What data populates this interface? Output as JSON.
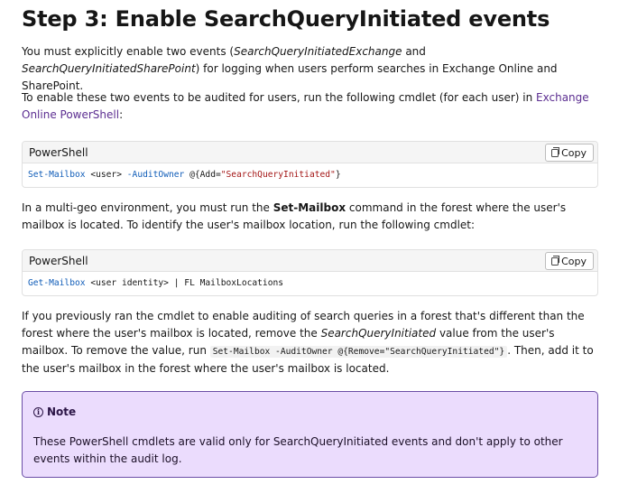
{
  "heading": "Step 3: Enable SearchQueryInitiated events",
  "p1": {
    "a": "You must explicitly enable two events (",
    "em1": "SearchQueryInitiatedExchange",
    "b": " and ",
    "em2": "SearchQueryInitiatedSharePoint",
    "c": ") for logging when users perform searches in Exchange Online and SharePoint."
  },
  "p2": {
    "a": "To enable these two events to be audited for users, run the following cmdlet (for each user) in ",
    "link": "Exchange Online PowerShell",
    "c": ":"
  },
  "code1": {
    "lang": "PowerShell",
    "copy_label": "Copy",
    "cmd": "Set-Mailbox",
    "arg": " <user> ",
    "param": "-AuditOwner",
    "pre": " @{Add=",
    "str": "\"SearchQueryInitiated\"",
    "post": "}"
  },
  "p3": {
    "a": "In a multi-geo environment, you must run the ",
    "strong": "Set-Mailbox",
    "c": " command in the forest where the user's mailbox is located. To identify the user's mailbox location, run the following cmdlet:"
  },
  "code2": {
    "lang": "PowerShell",
    "copy_label": "Copy",
    "cmd": "Get-Mailbox",
    "rest": " <user identity> | FL MailboxLocations"
  },
  "p4": {
    "a": "If you previously ran the cmdlet to enable auditing of search queries in a forest that's different than the forest where the user's mailbox is located, remove the ",
    "em": "SearchQueryInitiated",
    "b": " value from the user's mailbox. To remove the value, run ",
    "code": "Set-Mailbox -AuditOwner @{Remove=\"SearchQueryInitiated\"}",
    "c": ". Then, add it to the user's mailbox in the forest where the user's mailbox is located."
  },
  "note": {
    "title": "Note",
    "text": "These PowerShell cmdlets are valid only for SearchQueryInitiated events and don't apply to other events within the audit log."
  },
  "colors": {
    "link": "#5c2e91",
    "note_bg": "#ebdcfd",
    "note_border": "#6b4ea6",
    "code_keyword": "#0f5cb8",
    "code_string": "#a31515"
  },
  "icons": {
    "copy": "copy-icon",
    "info": "info-icon"
  }
}
